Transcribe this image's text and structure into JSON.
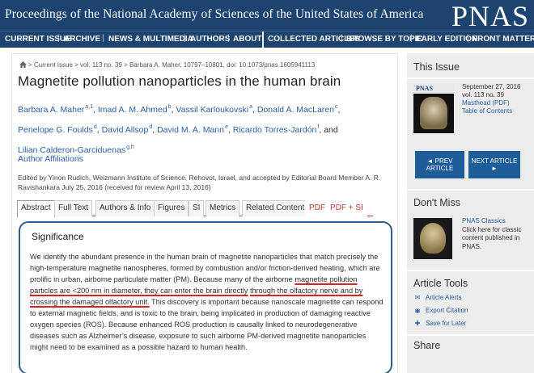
{
  "header": {
    "journal_name": "Proceedings of the National Academy of Sciences of the United States of America",
    "logo": "PNAS"
  },
  "nav": {
    "items": [
      "CURRENT ISSUE",
      "ARCHIVE",
      "NEWS & MULTIMEDIA",
      "AUTHORS",
      "ABOUT",
      "COLLECTED ARTICLES",
      "BROWSE BY TOPIC",
      "EARLY EDITION",
      "FRONT MATTER"
    ]
  },
  "article": {
    "breadcrumb": "> Current Issue  > vol. 113 no. 39  > Barbara A. Maher,  10797–10801, doi: 10.1073/pnas.1605941113",
    "title": "Magnetite pollution nanoparticles in the human brain",
    "authors": [
      {
        "name": "Barbara A. Maher",
        "sup": "a,1"
      },
      {
        "name": "Imad A. M. Ahmed",
        "sup": "b"
      },
      {
        "name": "Vassil Karloukovski",
        "sup": "a"
      },
      {
        "name": "Donald A. MacLaren",
        "sup": "c"
      },
      {
        "name": "Penelope G. Foulds",
        "sup": "d"
      },
      {
        "name": "David Allsop",
        "sup": "d"
      },
      {
        "name": "David M. A. Mann",
        "sup": "e"
      },
      {
        "name": "Ricardo Torres-Jardón",
        "sup": "f"
      },
      {
        "name": "Lilian Calderon-Garciduenas",
        "sup": "g,h"
      }
    ],
    "and_text": "and",
    "author_affiliations": "Author Affiliations",
    "edited_by": "Edited by Yinon Rudich, Weizmann Institute of Science, Rehovot, Israel, and accepted by Editorial Board Member A. R. Ravishankara July 25, 2016 (received for review April 13, 2016)"
  },
  "tabs": [
    "Abstract",
    "Full Text",
    "Authors & Info",
    "Figures",
    "SI",
    "Metrics",
    "Related Content",
    "PDF",
    "PDF + SI"
  ],
  "significance": {
    "title": "Significance",
    "text_1": "We identify the abundant presence in the human brain of magnetite nanoparticles that match precisely the high-temperature magnetite nanospheres, formed by combustion and/or friction-derived heating, which are prolific in urban, airborne particulate matter (PM). Because many of the airborne ",
    "highlight_1": "magnetite pollution particles are <200 nm in diameter, they can enter the brain directly",
    "highlight_2": "through the olfactory nerve and by crossing the damaged olfactory unit.",
    "text_2": " This discovery is important because nanoscale magnetite can respond to external magnetic fields, and is toxic to the brain, being implicated in production of damaging reactive oxygen species (ROS). Because enhanced ROS production is causally linked to neurodegenerative diseases such as Alzheimer’s disease, exposure to such airborne PM-derived magnetite nanoparticles might need to be examined as a possible hazard to human health."
  },
  "sidebar": {
    "this_issue": {
      "heading": "This Issue",
      "cover_label": "PNAS",
      "date": "September 27, 2016",
      "volume": "vol. 113 no. 39",
      "masthead": "Masthead (PDF)",
      "toc": "Table of Contents",
      "prev_label": "◄ PREV ARTICLE",
      "next_label": "NEXT ARTICLE ►"
    },
    "dont_miss": {
      "heading": "Don't Miss",
      "link": "PNAS Classics",
      "text": "Click here for classic content published in PNAS."
    },
    "article_tools": {
      "heading": "Article Tools",
      "items": [
        "Article Alerts",
        "Export Citation",
        "Save for Later"
      ]
    },
    "share": {
      "heading": "Share"
    }
  },
  "colors": {
    "nav_bg": "#1d4471",
    "link": "#2a5fa8",
    "highlight_underline": "#d22",
    "box_border": "#2e5d8e"
  }
}
